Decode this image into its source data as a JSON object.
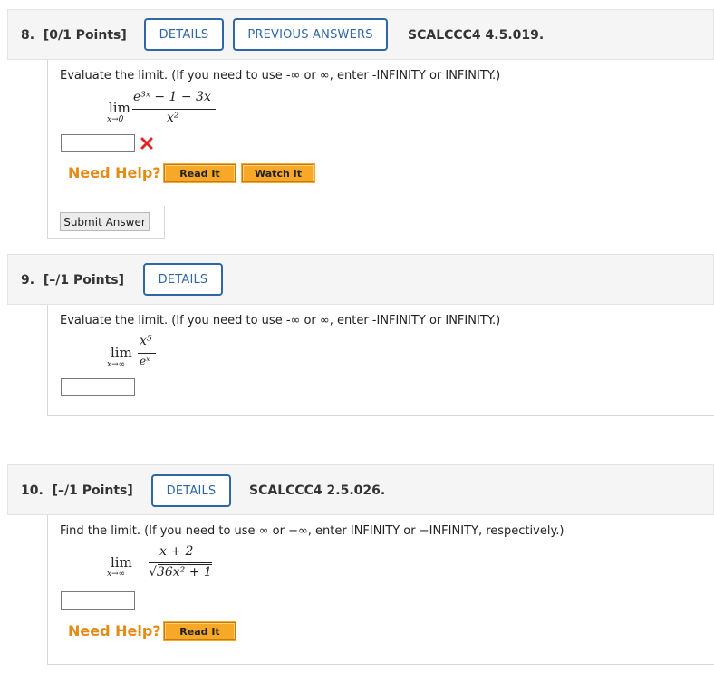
{
  "q8": {
    "number": "8.",
    "points": "[0/1 Points]",
    "details_label": "DETAILS",
    "previous_label": "PREVIOUS ANSWERS",
    "code": "SCALCCC4 4.5.019.",
    "prompt": "Evaluate the limit. (If you need to use -∞ or ∞, enter -INFINITY or INFINITY.)",
    "lim": "lim",
    "lim_sub": "x→0",
    "numerator": "e³ˣ − 1 − 3x",
    "denominator": "x²",
    "answer_value": "",
    "answer_status": "incorrect",
    "status_color": "#e02424",
    "need_help": "Need Help?",
    "read_it": "Read It",
    "watch_it": "Watch It",
    "submit": "Submit Answer"
  },
  "q9": {
    "number": "9.",
    "points": "[–/1 Points]",
    "details_label": "DETAILS",
    "prompt": "Evaluate the limit. (If you need to use -∞ or ∞, enter -INFINITY or INFINITY.)",
    "lim": "lim",
    "lim_sub": "x→∞",
    "numerator": "x⁵",
    "denominator": "eˣ",
    "answer_value": ""
  },
  "q10": {
    "number": "10.",
    "points": "[–/1 Points]",
    "details_label": "DETAILS",
    "code": "SCALCCC4 2.5.026.",
    "prompt": "Find the limit. (If you need to use ∞ or −∞, enter INFINITY or −INFINITY, respectively.)",
    "lim": "lim",
    "lim_sub": "x→∞",
    "numerator": "x + 2",
    "denominator": "√36x² + 1",
    "answer_value": "",
    "need_help": "Need Help?",
    "read_it": "Read It"
  },
  "colors": {
    "accent_blue": "#2f67a5",
    "help_orange": "#e58a13",
    "button_orange": "#f7a826"
  }
}
